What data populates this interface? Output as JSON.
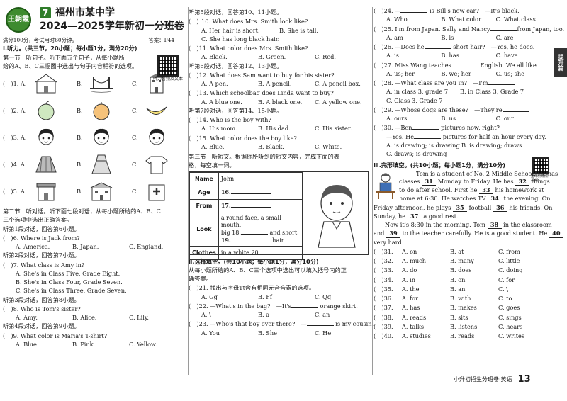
{
  "header": {
    "logo_text": "王朝霞",
    "number": "7",
    "school": "福州市某中学",
    "title": "2024—2025学年新初一分班卷",
    "score_note": "满分100分，考试用时60分钟。",
    "answer_ref": "答案：P44",
    "qr_caption": "听力音频及文本"
  },
  "section1": {
    "title": "Ⅰ.听力。(共三节，20小题；每小题1分，满分20分)",
    "part1_line1": "第一节　听句子。听下面五个句子，从每小题所",
    "part1_line2": "给的A、B、C三幅图中选出与句子内容相符的选项。",
    "pic_questions": [
      {
        "num": "(　)1. A.",
        "b": "B.",
        "c": "C.",
        "icons": [
          "house-icon",
          "bridge-icon",
          "building-icon"
        ]
      },
      {
        "num": "(　)2. A.",
        "b": "B.",
        "c": "C.",
        "icons": [
          "apple-icon",
          "orange-icon",
          "banana-icon"
        ]
      },
      {
        "num": "(　)3. A.",
        "b": "B.",
        "c": "C.",
        "icons": [
          "girl-face-icon",
          "girl-face-icon",
          "girl-face-icon"
        ]
      },
      {
        "num": "(　)4. A.",
        "b": "B.",
        "c": "C.",
        "icons": [
          "skirt-icon",
          "dress-icon",
          "shirt-icon"
        ]
      },
      {
        "num": "(　)5. A.",
        "b": "B.",
        "c": "C.",
        "icons": [
          "shop-icon",
          "school-icon",
          "hospital-icon"
        ]
      }
    ],
    "part2_line1": "第二节　听对话。听下面七段对话，从每小题所给的A、B、C",
    "part2_line2": "三个选项中选出正确答案。",
    "dialogs": [
      {
        "intro": "听第1段对话，回答第6小题。",
        "q": "(　)6. Where is Jack from?",
        "opts": [
          "A. America.",
          "B. Japan.",
          "C. England."
        ],
        "layout": "row"
      },
      {
        "intro": "听第2段对话，回答第7小题。",
        "q": "(　)7. What class is Amy in?",
        "opts": [
          "A. She's in Class Five, Grade Eight.",
          "B. She's in Class Four, Grade Seven.",
          "C. She's in Class Three, Grade Seven."
        ],
        "layout": "col"
      },
      {
        "intro": "听第3段对话，回答第8小题。",
        "q": "(　)8. Who is Tom's sister?",
        "opts": [
          "A. Amy.",
          "B. Alice.",
          "C. Lily."
        ],
        "layout": "row"
      },
      {
        "intro": "听第4段对话，回答第9小题。",
        "q": "(　)9. What color is Maria's T-shirt?",
        "opts": [
          "A. Blue.",
          "B. Pink.",
          "C. Yellow."
        ],
        "layout": "row"
      }
    ]
  },
  "col2": {
    "intro5": "听第5段对话，回答第10、11小题。",
    "q10": "10. What does Mrs. Smith look like?",
    "q10_opts": [
      "A. Her hair is short.",
      "B. She is tall.",
      "C. She has long black hair."
    ],
    "q11": "(　)11. What color does Mrs. Smith like?",
    "q11_opts": [
      "A. Black.",
      "B. Green.",
      "C. Red."
    ],
    "intro6": "听第6段对话，回答第12、13小题。",
    "q12": "(　)12. What does Sam want to buy for his sister?",
    "q12_opts": [
      "A. A pen.",
      "B. A pencil.",
      "C. A pencil box."
    ],
    "q13": "(　)13. Which schoolbag does Linda want to buy?",
    "q13_opts": [
      "A. A blue one.",
      "B. A black one.",
      "C. A yellow one."
    ],
    "intro7": "听第7段对话，回答第14、15小题。",
    "q14": "(　)14. Who is the boy with?",
    "q14_opts": [
      "A. His mom.",
      "B. His dad.",
      "C. His sister."
    ],
    "q15": "(　)15. What color does the boy like?",
    "q15_opts": [
      "A. Blue.",
      "B. Black.",
      "C. White."
    ],
    "part3_line1": "第三节　听短文。根据你所听到的短文内容，完成下面的表",
    "part3_line2": "格，每空填一词。",
    "table": {
      "name_k": "Name",
      "name_v": "John",
      "age_k": "Age",
      "age_v": "16.",
      "from_k": "From",
      "from_v": "17.",
      "look_k": "Look",
      "look_v1": "a round face, a small mouth,",
      "look_v2": "big 18.",
      "look_v2b": "and short",
      "look_v3": "19.",
      "look_v3b": "hair",
      "clothes_k": "Clothes",
      "clothes_v": "in a white 20."
    },
    "section2_title": "Ⅱ.选择填空。(共10小题；每小题1分，满分10分)",
    "section2_line1": "从每小题所给的A、B、C三个选项中选出可以填入括号内的正",
    "section2_line2": "确答案。",
    "q21": "(　)21. 找出与字母Tt含有相同元音音素的选项。",
    "q21_opts": [
      "A. Gg",
      "B. Ff",
      "C. Qq"
    ],
    "q22": "(　)22. —What's in the bag?　—It's",
    "q22_tail": "orange skirt.",
    "q22_opts": [
      "A. \\",
      "B. a",
      "C. an"
    ],
    "q23": "(　)23. —Who's that boy over there?　—",
    "q23_tail": "is my cousin.",
    "q23_opts": [
      "A. You",
      "B. She",
      "C. He"
    ]
  },
  "col3": {
    "q24": "(　)24. —",
    "q24_tail": "is Bill's new car?　—It's black.",
    "q24_opts": [
      "A. Who",
      "B. What color",
      "C. What class"
    ],
    "q25": "(　)25. I'm from Japan. Sally and Nancy",
    "q25_tail": "from Japan, too.",
    "q25_opts": [
      "A. am",
      "B. is",
      "C. are"
    ],
    "q26": "(　)26. —Does he",
    "q26_tail": "short hair?　—Yes, he does.",
    "q26_opts": [
      "A. is",
      "B. has",
      "C. have"
    ],
    "q27": "(　)27. Miss Wang teaches",
    "q27_tail": "English. We all like",
    "q27_opts": [
      "A. us; her",
      "B. we; her",
      "C. us; she"
    ],
    "q28": "(　)28. —What class are you in?　—I'm",
    "q28_opts": [
      "A. in class 3, grade 7",
      "B. in Class 3, Grade 7",
      "C. Class 3, Grade 7"
    ],
    "q29": "(　)29. —Whose dogs are these?　—They're",
    "q29_opts": [
      "A. ours",
      "B. us",
      "C. our"
    ],
    "q30": "(　)30. —Ben",
    "q30_tail": "pictures now, right?",
    "q30_line2": "—Yes. He",
    "q30_line2_tail": "pictures for half an hour every day.",
    "q30_opts_a": "A. is drawing; is drawing",
    "q30_opts_b": "B. is drawing; draws",
    "q30_opts_c": "C. draws; is drawing",
    "qr_caption": "重难点精讲视频",
    "section3_title": "Ⅲ.完形填空。(共10小题；每小题1分，满分10分)",
    "passage": [
      {
        "t": "Tom is a student of No. 2 Middle School. He has"
      },
      {
        "t": "classes",
        "n": "31",
        "t2": "Monday to Friday. He has",
        "n2": "32",
        "t3": "things"
      },
      {
        "t": "to do after school. First he",
        "n": "33",
        "t2": "his homework at"
      },
      {
        "t": "home at 6:30. He watches TV",
        "n": "34",
        "t2": "the evening. On"
      },
      {
        "t": "Friday afternoon, he plays",
        "n": "35",
        "t2": "football",
        "n2": "36",
        "t3": "his friends. On"
      },
      {
        "t": "Sunday, he",
        "n": "37",
        "t2": "a good rest."
      },
      {
        "t": "Now it's 8:30 in the morning. Tom",
        "n": "38",
        "t2": "in the classroom"
      },
      {
        "t": "and",
        "n": "39",
        "t2": "to the teacher carefully. He is a good student. He",
        "n2": "40"
      },
      {
        "t": "very hard."
      }
    ],
    "cloze": [
      {
        "q": "(　)31.",
        "a": "A. on",
        "b": "B. at",
        "c": "C. from"
      },
      {
        "q": "(　)32.",
        "a": "A. much",
        "b": "B. many",
        "c": "C. little"
      },
      {
        "q": "(　)33.",
        "a": "A. do",
        "b": "B. does",
        "c": "C. doing"
      },
      {
        "q": "(　)34.",
        "a": "A. in",
        "b": "B. on",
        "c": "C. for"
      },
      {
        "q": "(　)35.",
        "a": "A. the",
        "b": "B. an",
        "c": "C. \\"
      },
      {
        "q": "(　)36.",
        "a": "A. for",
        "b": "B. with",
        "c": "C. to"
      },
      {
        "q": "(　)37.",
        "a": "A. has",
        "b": "B. makes",
        "c": "C. goes"
      },
      {
        "q": "(　)38.",
        "a": "A. reads",
        "b": "B. sits",
        "c": "C. sings"
      },
      {
        "q": "(　)39.",
        "a": "A. talks",
        "b": "B. listens",
        "c": "C. hears"
      },
      {
        "q": "(　)40.",
        "a": "A. studies",
        "b": "B. reads",
        "c": "C. writes"
      }
    ],
    "side_tab": "提升篇",
    "footer_text": "小升初招生分班卷·英语",
    "page_number": "13"
  },
  "colors": {
    "accent": "#2f7d2a",
    "text": "#1a1a1a",
    "divider": "#9a9a9a"
  }
}
